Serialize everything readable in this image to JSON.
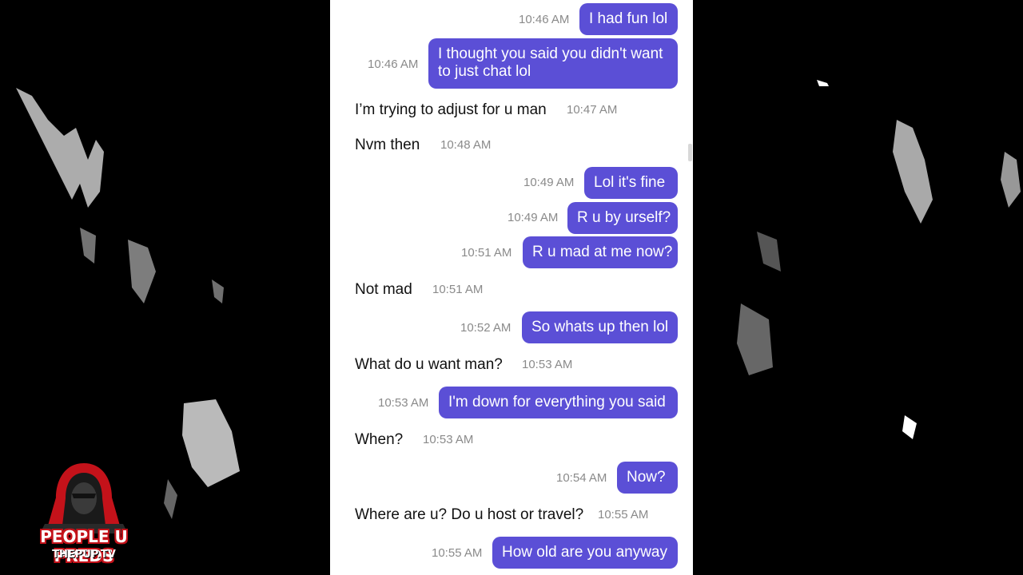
{
  "messages": [
    {
      "side": "out",
      "text": "I had fun lol",
      "time": "10:46 AM"
    },
    {
      "side": "out",
      "text": "I thought you said you didn't want to just chat lol",
      "time": "10:46 AM"
    },
    {
      "side": "in",
      "text": "I’m trying to adjust for u man",
      "time": "10:47 AM"
    },
    {
      "side": "in",
      "text": "Nvm then",
      "time": "10:48 AM"
    },
    {
      "side": "out",
      "text": "Lol it's fine",
      "time": "10:49 AM"
    },
    {
      "side": "out",
      "text": "R u by urself?",
      "time": "10:49 AM"
    },
    {
      "side": "out",
      "text": "R u mad at me now?",
      "time": "10:51 AM"
    },
    {
      "side": "in",
      "text": "Not mad",
      "time": "10:51 AM"
    },
    {
      "side": "out",
      "text": "So whats up then lol",
      "time": "10:52 AM"
    },
    {
      "side": "in",
      "text": "What do u want man?",
      "time": "10:53 AM"
    },
    {
      "side": "out",
      "text": "I'm down for everything you said",
      "time": "10:53 AM"
    },
    {
      "side": "in",
      "text": "When?",
      "time": "10:53 AM"
    },
    {
      "side": "out",
      "text": "Now?",
      "time": "10:54 AM"
    },
    {
      "side": "in",
      "text": "Where are u? Do u host or travel?",
      "time": "10:55 AM"
    },
    {
      "side": "out",
      "text": "How old are you anyway",
      "time": "10:55 AM"
    }
  ],
  "watermark": {
    "title": "PEOPLE U PREDS",
    "subtitle": "THEPUP.TV",
    "icon": "hooded-figure-icon"
  },
  "colors": {
    "outgoing_bubble": "#5b4fd6",
    "incoming_text": "#111111",
    "timestamp": "#8a8a8a",
    "brand_red": "#c4121a"
  }
}
